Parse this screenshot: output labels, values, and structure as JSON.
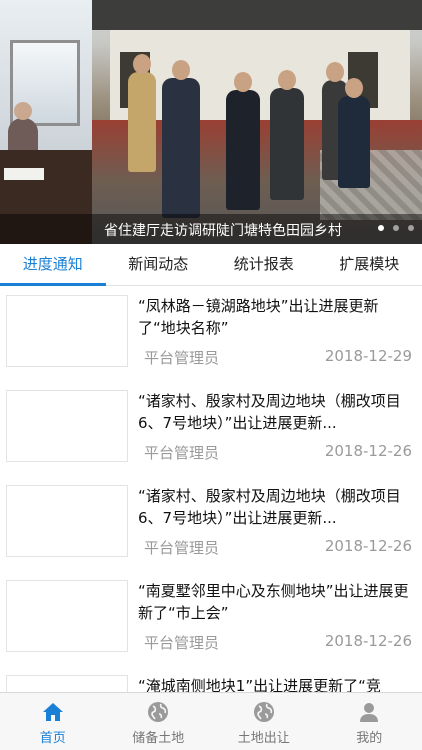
{
  "banner": {
    "caption": "省住建厅走访调研陡门塘特色田园乡村",
    "slides": 3,
    "active_slide": 1
  },
  "tabs": [
    {
      "label": "进度通知",
      "active": true
    },
    {
      "label": "新闻动态",
      "active": false
    },
    {
      "label": "统计报表",
      "active": false
    },
    {
      "label": "扩展模块",
      "active": false
    }
  ],
  "list": [
    {
      "title": "“凤林路－镜湖路地块”出让进展更新了“地块名称”",
      "author": "平台管理员",
      "date": "2018-12-29"
    },
    {
      "title": "“诸家村、殷家村及周边地块（棚改项目6、7号地块）”出让进展更新...",
      "author": "平台管理员",
      "date": "2018-12-26"
    },
    {
      "title": "“诸家村、殷家村及周边地块（棚改项目6、7号地块）”出让进展更新...",
      "author": "平台管理员",
      "date": "2018-12-26"
    },
    {
      "title": "“南夏墅邻里中心及东侧地块”出让进展更新了“市上会”",
      "author": "平台管理员",
      "date": "2018-12-26"
    },
    {
      "title": "“淹城南侧地块1”出让进展更新了“竞",
      "author": "",
      "date": ""
    }
  ],
  "bottom_nav": [
    {
      "label": "首页",
      "icon": "home-icon",
      "active": true
    },
    {
      "label": "储备土地",
      "icon": "globe-icon",
      "active": false
    },
    {
      "label": "土地出让",
      "icon": "globe-icon",
      "active": false
    },
    {
      "label": "我的",
      "icon": "user-icon",
      "active": false
    }
  ],
  "colors": {
    "accent": "#1a7fd6",
    "inactive": "#999999"
  }
}
